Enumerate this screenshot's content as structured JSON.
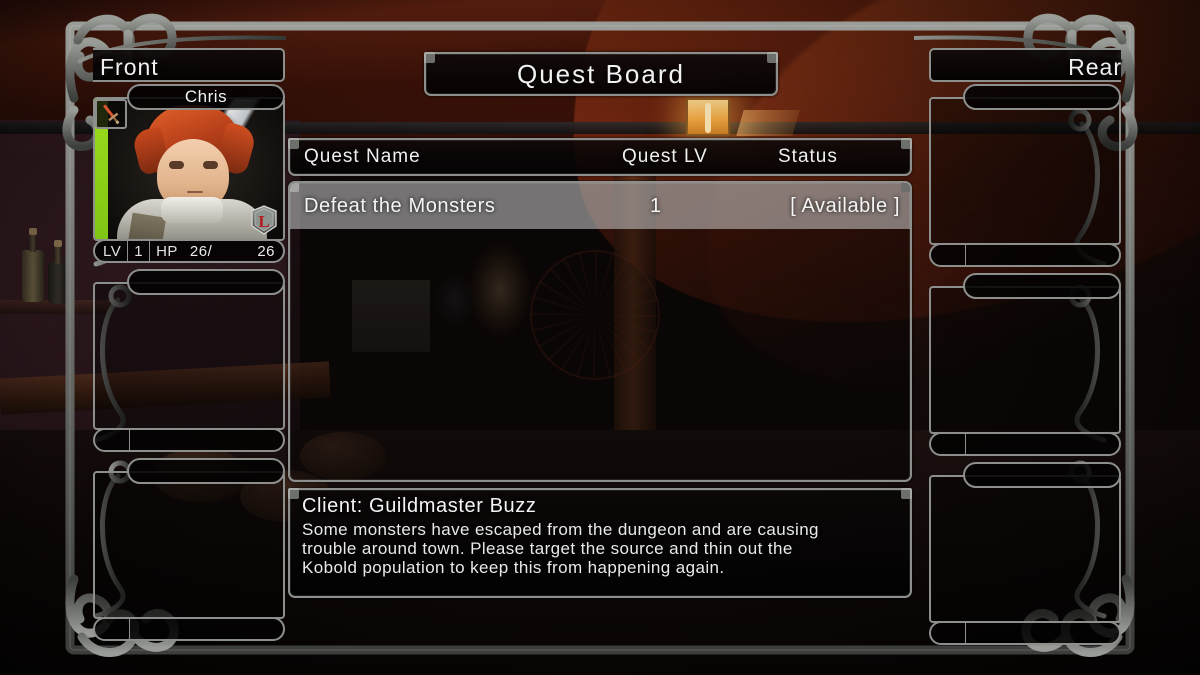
{
  "window": {
    "title": "Quest Board"
  },
  "party": {
    "front_label": "Front",
    "rear_label": "Rear",
    "front_members": [
      {
        "name": "Chris",
        "lv_label": "LV",
        "lv_value": "1",
        "hp_label": "HP",
        "hp_current": "26",
        "hp_separator": "/",
        "hp_max": "26",
        "class_badge": "L",
        "weapon_icon": "sword-icon",
        "hp_bar_color": "#9ddd1c",
        "occupied": true
      },
      {
        "name": "",
        "occupied": false
      },
      {
        "name": "",
        "occupied": false
      }
    ],
    "rear_members": [
      {
        "name": "",
        "occupied": false
      },
      {
        "name": "",
        "occupied": false
      },
      {
        "name": "",
        "occupied": false
      }
    ]
  },
  "quest_table": {
    "columns": {
      "name": "Quest Name",
      "level": "Quest LV",
      "status": "Status"
    },
    "rows": [
      {
        "name": "Defeat the Monsters",
        "level": "1",
        "status": "[ Available ]",
        "selected": true
      }
    ]
  },
  "quest_detail": {
    "client_line": "Client: Guildmaster Buzz",
    "description": "Some monsters have escaped from the dungeon and are causing\ntrouble around town. Please target the source and thin out the\nKobold population to keep this from happening again."
  },
  "colors": {
    "frame_metal": "#8d8f8c",
    "panel_fill": "#040303",
    "text_primary": "#f2f2f2",
    "row_highlight": "#d8d8d8",
    "hp_green": "#9ddd1c",
    "badge_red": "#b01f22",
    "tavern_warm": "#7a2a14"
  }
}
